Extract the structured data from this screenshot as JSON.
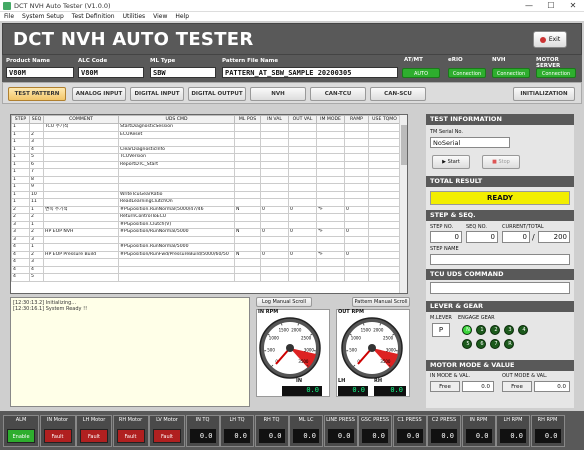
{
  "window": {
    "title": "DCT NVH Auto Tester (V1.0.0)",
    "minimize": "—",
    "maximize": "☐",
    "close": "✕"
  },
  "menu": [
    "File",
    "System Setup",
    "Test Definition",
    "Utilities",
    "View",
    "Help"
  ],
  "banner": {
    "title": "DCT NVH AUTO TESTER",
    "exit_label": "Exit"
  },
  "info": {
    "product_name": {
      "label": "Product Name",
      "value": "V80M"
    },
    "alc_code": {
      "label": "ALC Code",
      "value": "V80M"
    },
    "ml_type": {
      "label": "ML Type",
      "value": "SBW"
    },
    "pattern_file": {
      "label": "Pattern File Name",
      "value": "PATTERN_AT_SBW_SAMPLE 20200305"
    },
    "atmt": {
      "label": "AT/MT",
      "value": "AUTO"
    },
    "erio": {
      "label": "eRIO",
      "value": "Connection"
    },
    "nvh": {
      "label": "NVH",
      "value": "Connection"
    },
    "motor_server": {
      "label": "MOTOR SERVER",
      "value": "Connection"
    }
  },
  "tabs": [
    "TEST PATTERN",
    "ANALOG INPUT",
    "DIGITAL INPUT",
    "DIGITAL OUTPUT",
    "NVH",
    "CAN-TCU",
    "CAN-SCU",
    "INITIALIZATION"
  ],
  "grid": {
    "columns": [
      "STEP",
      "SEQ",
      "COMMENT",
      "UDS CMD",
      "ML POS",
      "IN VAL",
      "OUT VAL",
      "IM MODE",
      "RAMP",
      "USE TQMO"
    ],
    "rows": [
      [
        "1",
        "",
        "TCU 주기적",
        "StartDiagnosticSession",
        "",
        "",
        "",
        "",
        "",
        ""
      ],
      [
        "1",
        "2",
        "",
        "ECUReset",
        "",
        "",
        "",
        "",
        "",
        ""
      ],
      [
        "1",
        "3",
        "",
        "",
        "",
        "",
        "",
        "",
        "",
        ""
      ],
      [
        "1",
        "4",
        "",
        "ClearDiagnosticInfo",
        "",
        "",
        "",
        "",
        "",
        ""
      ],
      [
        "1",
        "5",
        "",
        "TCUVersion",
        "",
        "",
        "",
        "",
        "",
        ""
      ],
      [
        "1",
        "6",
        "",
        "ReportDTC_Start",
        "",
        "",
        "",
        "",
        "",
        ""
      ],
      [
        "1",
        "7",
        "",
        "",
        "",
        "",
        "",
        "",
        "",
        ""
      ],
      [
        "1",
        "8",
        "",
        "",
        "",
        "",
        "",
        "",
        "",
        ""
      ],
      [
        "1",
        "9",
        "",
        "",
        "",
        "",
        "",
        "",
        "",
        ""
      ],
      [
        "1",
        "10",
        "",
        "WriteTcuGearRatio",
        "",
        "",
        "",
        "",
        "",
        ""
      ],
      [
        "1",
        "11",
        "",
        "ReadLearningClutchOn",
        "",
        "",
        "",
        "",
        "",
        ""
      ],
      [
        "2",
        "1",
        "변속 주기적",
        "#PGposition.RunNormal(5000/47/46",
        "N",
        "0",
        "0",
        "*F",
        "0",
        ""
      ],
      [
        "2",
        "2",
        "",
        "ReturnControlToECU",
        "",
        "",
        "",
        "",
        "",
        ""
      ],
      [
        "3",
        "1",
        "",
        "#PGposition.Clutch(V)",
        "",
        "",
        "",
        "",
        "",
        ""
      ],
      [
        "3",
        "2",
        "HP EOP NVH",
        "#PGposition/RunNormal/5000",
        "N",
        "0",
        "0",
        "*F",
        "0",
        ""
      ],
      [
        "3",
        "3",
        "",
        "",
        "",
        "",
        "",
        "",
        "",
        ""
      ],
      [
        "4",
        "1",
        "",
        "#PGposition.RunNormal/5000",
        "",
        "",
        "",
        "",
        "",
        ""
      ],
      [
        "4",
        "2",
        "HP EOP Pressure Build",
        "#PGposition/RunFwd/PressureBuild/5000/60/50",
        "N",
        "0",
        "0",
        "*F",
        "0",
        ""
      ],
      [
        "4",
        "3",
        "",
        "",
        "",
        "",
        "",
        "",
        "",
        ""
      ],
      [
        "4",
        "4",
        "",
        "",
        "",
        "",
        "",
        "",
        "",
        ""
      ],
      [
        "4",
        "5",
        "",
        "",
        "",
        "",
        "",
        "",
        "",
        ""
      ]
    ]
  },
  "log": {
    "lines": [
      "[12:30:13.2] Initializing...",
      "[12:30:16.1] System Ready !!"
    ],
    "log_scroll": "Log Manual Scroll",
    "pattern_scroll": "Pattern Manual Scroll"
  },
  "gauges": {
    "in": {
      "title": "IN RPM",
      "label": "IN",
      "value": "0.0",
      "ticks": [
        "0",
        "500",
        "1000",
        "1500",
        "2000",
        "2500",
        "3000",
        "3500"
      ]
    },
    "out": {
      "title": "OUT RPM",
      "label": "OUT",
      "value": "0.0",
      "ticks": [
        "0",
        "500",
        "1000",
        "1500",
        "2000",
        "2500",
        "3000",
        "3500"
      ]
    },
    "lh": {
      "label": "LH",
      "value": "0.0"
    },
    "rh": {
      "label": "RH",
      "value": "0.0"
    }
  },
  "right": {
    "test_info": {
      "header": "TEST INFORMATION",
      "serial_label": "TM Serial No.",
      "serial_value": "NoSerial",
      "start": "Start",
      "stop": "Stop"
    },
    "total_result": {
      "header": "TOTAL RESULT",
      "value": "READY"
    },
    "step": {
      "header": "STEP & SEQ.",
      "step_label": "STEP NO.",
      "step_value": "0",
      "seq_label": "SEQ NO.",
      "seq_value": "0",
      "cur_label": "CURRENT/TOTAL",
      "cur_value": "0",
      "total_value": "200",
      "slash": "/",
      "name_label": "STEP NAME"
    },
    "uds": {
      "header": "TCU UDS COMMAND"
    },
    "lever": {
      "header": "LEVER & GEAR",
      "ml_label": "M.LEVER",
      "ml_value": "P",
      "eg_label": "ENGAGE GEAR",
      "leds": [
        "N",
        "1",
        "2",
        "3",
        "4",
        "5",
        "6",
        "7",
        "R"
      ]
    },
    "motor": {
      "header": "MOTOR MODE & VALUE",
      "in_label": "IN MODE & VAL.",
      "in_mode": "Free",
      "in_val": "0.0",
      "out_label": "OUT MODE & VAL.",
      "out_mode": "Free",
      "out_val": "0.0"
    }
  },
  "bottom": [
    {
      "label": "ALM",
      "btn": "Enable",
      "kind": "green"
    },
    {
      "label": "IN Motor",
      "btn": "Fault",
      "kind": "red"
    },
    {
      "label": "LH Motor",
      "btn": "Fault",
      "kind": "red"
    },
    {
      "label": "RH Motor",
      "btn": "Fault",
      "kind": "red"
    },
    {
      "label": "LV Motor",
      "btn": "Fault",
      "kind": "red"
    },
    {
      "label": "IN TQ",
      "val": "0.0"
    },
    {
      "label": "LH TQ",
      "val": "0.0"
    },
    {
      "label": "RH TQ",
      "val": "0.0"
    },
    {
      "label": "ML LC",
      "val": "0.0"
    },
    {
      "label": "LINE PRESS",
      "val": "0.0"
    },
    {
      "label": "GSC PRESS",
      "val": "0.0"
    },
    {
      "label": "C1 PRESS",
      "val": "0.0"
    },
    {
      "label": "C2 PRESS",
      "val": "0.0"
    },
    {
      "label": "IN RPM",
      "val": "0.0"
    },
    {
      "label": "LH RPM",
      "val": "0.0"
    },
    {
      "label": "RH RPM",
      "val": "0.0"
    }
  ],
  "colors": {
    "banner": "#595959",
    "ok": "#2eae2e",
    "fault": "#b02020",
    "ready": "#f2ee00",
    "active_tab": "#f2c56a"
  }
}
